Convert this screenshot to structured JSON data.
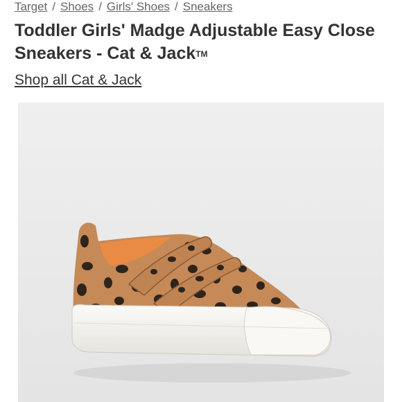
{
  "breadcrumb": {
    "items": [
      "Target",
      "Shoes",
      "Girls' Shoes",
      "Sneakers"
    ],
    "separator": "/"
  },
  "product": {
    "title_text": "Toddler Girls' Madge Adjustable Easy Close Sneakers - Cat & Jack",
    "trademark": "TM",
    "brand_link": "Shop all Cat & Jack"
  },
  "image": {
    "subject": "leopard-print-velcro-sneaker",
    "colors": {
      "background": "#ebebeb",
      "canvas": "#c58a58",
      "spots": "#2e241c",
      "sole": "#f7f5f1",
      "lining": "#e98a45"
    }
  }
}
